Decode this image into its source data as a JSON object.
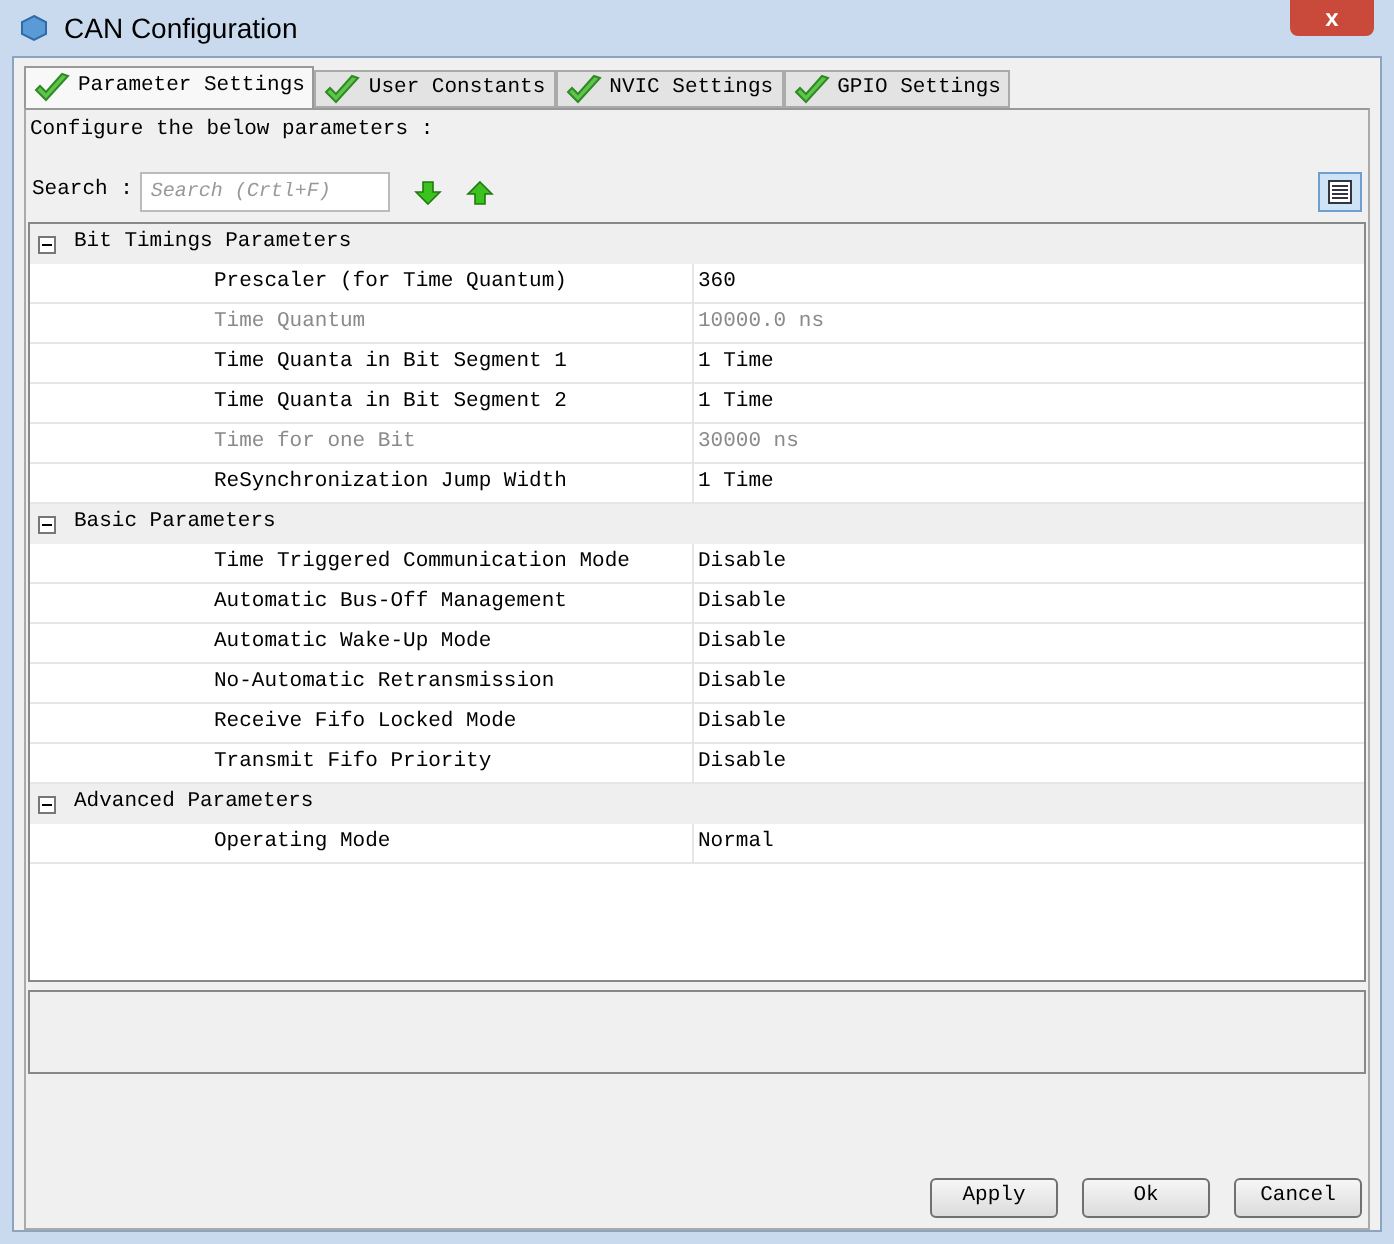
{
  "window": {
    "title": "CAN Configuration",
    "close": "x"
  },
  "tabs": [
    {
      "label": "Parameter Settings",
      "selected": true,
      "checked": true
    },
    {
      "label": "User Constants",
      "selected": false,
      "checked": true
    },
    {
      "label": "NVIC Settings",
      "selected": false,
      "checked": true
    },
    {
      "label": "GPIO Settings",
      "selected": false,
      "checked": true
    }
  ],
  "intro": "Configure the below parameters :",
  "search": {
    "label": "Search :",
    "placeholder": "Search (Crtl+F)"
  },
  "groups": [
    {
      "title": "Bit Timings Parameters",
      "expanded": true,
      "rows": [
        {
          "name": "Prescaler (for Time Quantum)",
          "value": "360",
          "disabled": false
        },
        {
          "name": "Time Quantum",
          "value": "10000.0 ns",
          "disabled": true
        },
        {
          "name": "Time Quanta in Bit Segment 1",
          "value": "1 Time",
          "disabled": false
        },
        {
          "name": "Time Quanta in Bit Segment 2",
          "value": "1 Time",
          "disabled": false
        },
        {
          "name": "Time for one Bit",
          "value": "30000 ns",
          "disabled": true
        },
        {
          "name": "ReSynchronization Jump Width",
          "value": "1 Time",
          "disabled": false
        }
      ]
    },
    {
      "title": "Basic Parameters",
      "expanded": true,
      "rows": [
        {
          "name": "Time Triggered Communication Mode",
          "value": "Disable",
          "disabled": false
        },
        {
          "name": "Automatic Bus-Off Management",
          "value": "Disable",
          "disabled": false
        },
        {
          "name": "Automatic Wake-Up Mode",
          "value": "Disable",
          "disabled": false
        },
        {
          "name": "No-Automatic Retransmission",
          "value": "Disable",
          "disabled": false
        },
        {
          "name": "Receive Fifo Locked Mode",
          "value": "Disable",
          "disabled": false
        },
        {
          "name": "Transmit Fifo Priority",
          "value": "Disable",
          "disabled": false
        }
      ]
    },
    {
      "title": "Advanced Parameters",
      "expanded": true,
      "rows": [
        {
          "name": "Operating Mode",
          "value": "Normal",
          "disabled": false
        }
      ]
    }
  ],
  "buttons": [
    "Apply",
    "Ok",
    "Cancel"
  ]
}
